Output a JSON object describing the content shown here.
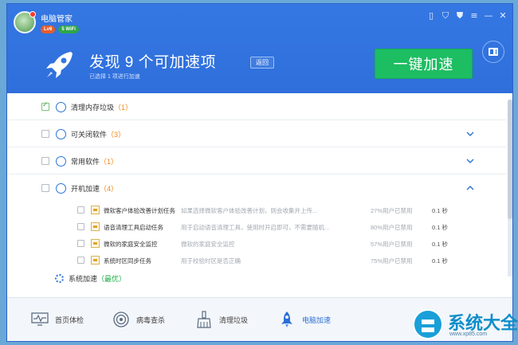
{
  "app": {
    "title": "电脑管家",
    "badge_level": "Lv6",
    "badge_wifi": "5 WiFi"
  },
  "header": {
    "headline": "发现 9 个可加速项",
    "back_label": "返回",
    "subtext": "已选择 1 项进行加速",
    "accelerate_label": "一键加速"
  },
  "window_controls": [
    "phone-icon",
    "shield-icon",
    "shirt-icon",
    "menu-icon",
    "minimize-icon",
    "close-icon"
  ],
  "categories": [
    {
      "label": "清理内存垃圾",
      "count": "（1）",
      "checked": true,
      "icon": "timer-icon",
      "expanded": null
    },
    {
      "label": "可关闭软件",
      "count": "（3）",
      "checked": false,
      "icon": "target-icon",
      "expanded": false
    },
    {
      "label": "常用软件",
      "count": "（1）",
      "checked": false,
      "icon": "blocked-icon",
      "expanded": false
    },
    {
      "label": "开机加速",
      "count": "（4）",
      "checked": false,
      "icon": "power-icon",
      "expanded": true
    }
  ],
  "startup_items": [
    {
      "name": "微软客户体验改善计划任务",
      "desc": "如果选择微软客户体验改善计划，则会收集并上传...",
      "pct": "27%用户已禁用",
      "time": "0.1 秒"
    },
    {
      "name": "语音清理工具启动任务",
      "desc": "用于启动语音清理工具，使用时开启即可，不需要随机...",
      "pct": "80%用户已禁用",
      "time": "0.1 秒"
    },
    {
      "name": "微软的家庭安全监控",
      "desc": "微软的家庭安全监控",
      "pct": "57%用户已禁用",
      "time": "0.1 秒"
    },
    {
      "name": "系统时区同步任务",
      "desc": "用于校验时区是否正确",
      "pct": "75%用户已禁用",
      "time": "0.1 秒"
    }
  ],
  "system": {
    "label": "系统加速",
    "status": "（最优）"
  },
  "footer": {
    "nav": [
      {
        "label": "首页体检",
        "icon": "monitor-icon"
      },
      {
        "label": "病毒查杀",
        "icon": "radar-icon"
      },
      {
        "label": "清理垃圾",
        "icon": "broom-icon"
      },
      {
        "label": "电脑加速",
        "icon": "rocket-icon",
        "active": true
      }
    ]
  },
  "watermark": {
    "text": "系统大全",
    "url": "www.xp85.com"
  },
  "colors": {
    "header_blue": "#3477e3",
    "accent_green": "#1dbd62",
    "count_orange": "#f08a1c"
  }
}
